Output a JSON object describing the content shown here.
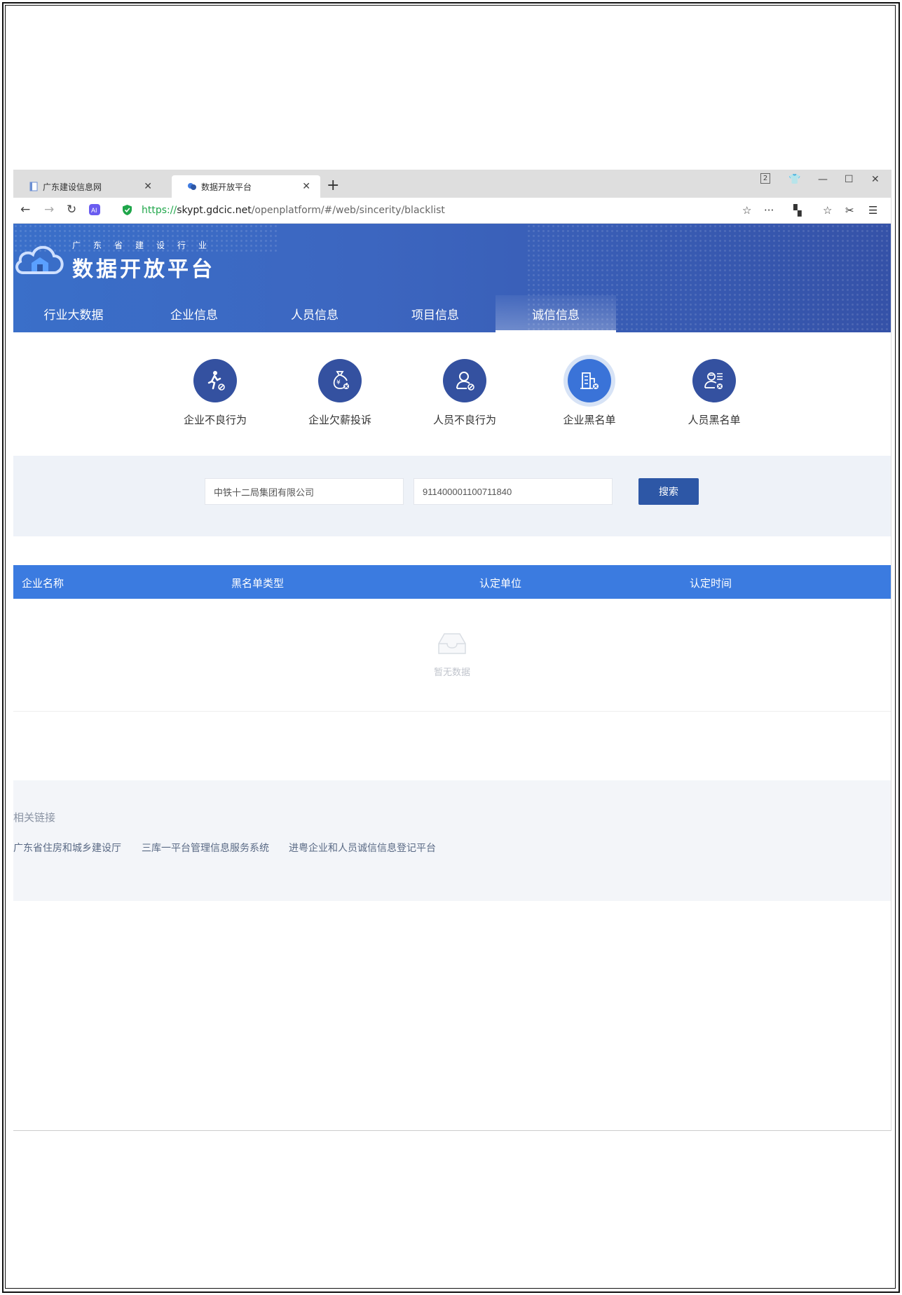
{
  "browser": {
    "tabs": [
      {
        "title": "广东建设信息网",
        "active": false
      },
      {
        "title": "数据开放平台",
        "active": true
      }
    ],
    "url": {
      "scheme": "https://",
      "host": "skypt.gdcic.net",
      "path": "/openplatform/#/web/sincerity/blacklist"
    },
    "window_badge": "2"
  },
  "header": {
    "logo_subtitle": "广东省建设行业",
    "logo_title": "数据开放平台"
  },
  "nav": [
    {
      "label": "行业大数据"
    },
    {
      "label": "企业信息"
    },
    {
      "label": "人员信息"
    },
    {
      "label": "项目信息"
    },
    {
      "label": "诚信信息",
      "active": true
    }
  ],
  "categories": [
    {
      "label": "企业不良行为",
      "icon": "running-person-icon"
    },
    {
      "label": "企业欠薪投诉",
      "icon": "money-bag-icon"
    },
    {
      "label": "人员不良行为",
      "icon": "person-icon"
    },
    {
      "label": "企业黑名单",
      "icon": "building-icon",
      "active": true
    },
    {
      "label": "人员黑名单",
      "icon": "person-list-icon"
    }
  ],
  "search": {
    "company_value": "中铁十二局集团有限公司",
    "code_value": "911400001100711840",
    "button_label": "搜索"
  },
  "table": {
    "columns": [
      "企业名称",
      "黑名单类型",
      "认定单位",
      "认定时间"
    ],
    "rows": [],
    "empty_text": "暂无数据"
  },
  "footer": {
    "title": "相关链接",
    "links": [
      "广东省住房和城乡建设厅",
      "三库一平台管理信息服务系统",
      "进粤企业和人员诚信信息登记平台"
    ]
  },
  "colors": {
    "header_blue": "#3a6fc9",
    "table_header": "#3b7be0",
    "button": "#2d57a6",
    "icon_circle": "#3451a0"
  }
}
